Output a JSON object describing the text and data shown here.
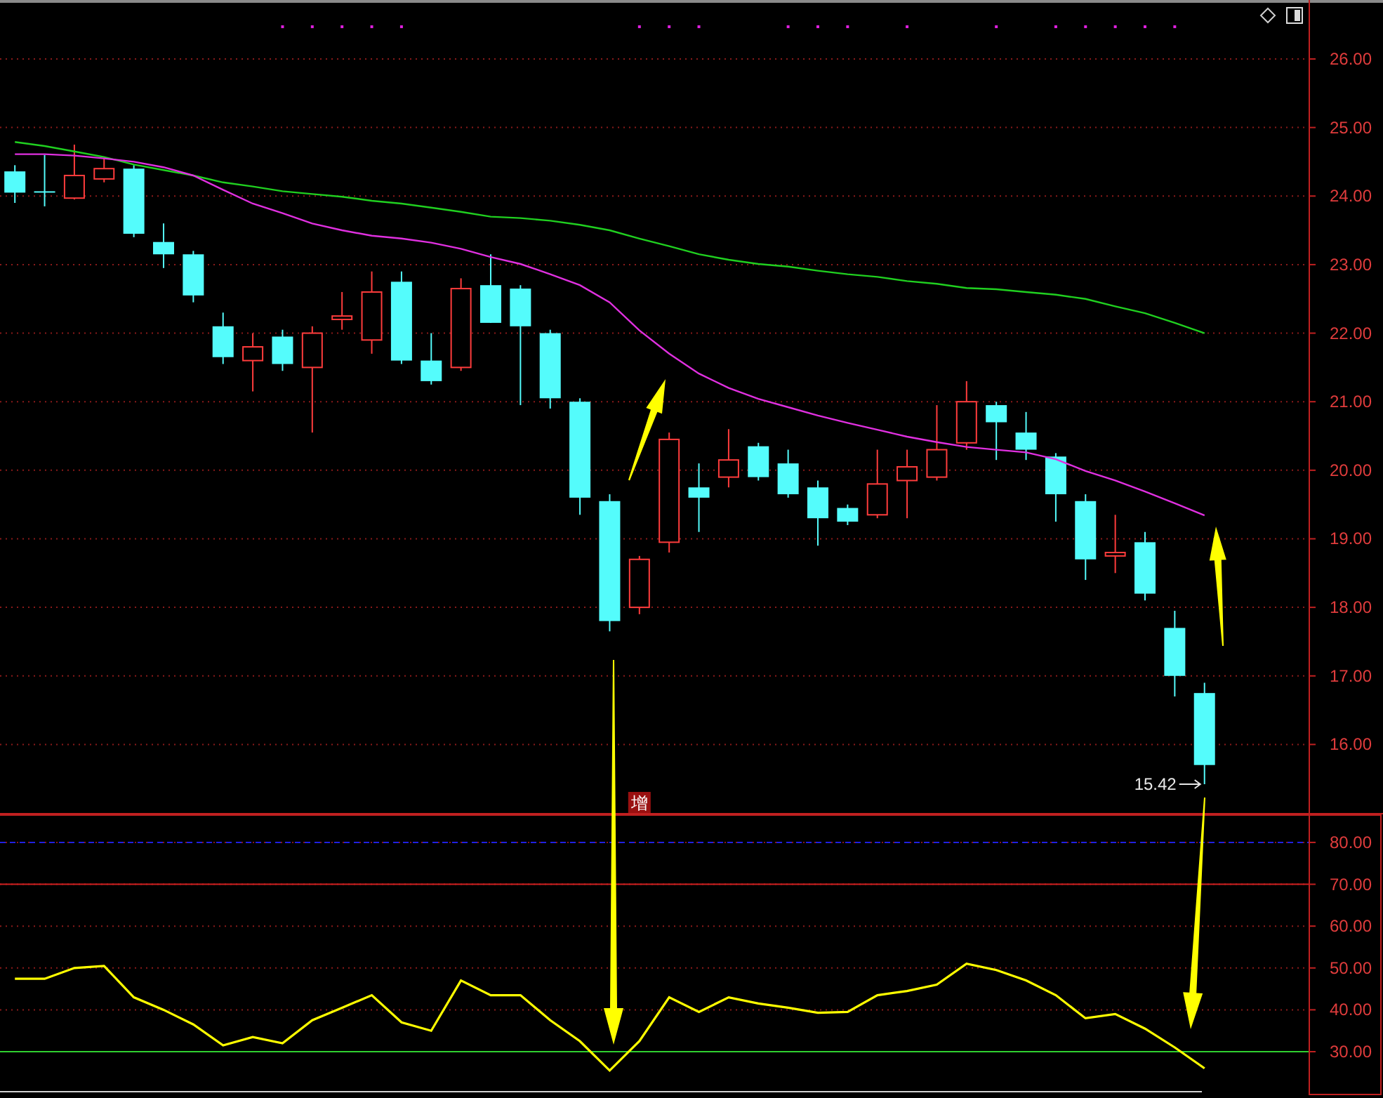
{
  "main_chart": {
    "chart_data": {
      "type": "candlestick",
      "grid": true,
      "ylim": [
        14.98,
        26.86
      ],
      "categories": [
        null,
        null,
        null,
        null,
        null,
        null,
        null,
        null,
        null,
        null,
        null,
        null,
        null,
        null,
        null,
        null,
        null,
        null,
        null,
        null,
        null,
        null,
        null,
        null,
        null,
        null,
        null,
        null,
        null,
        null,
        null,
        null,
        null,
        null,
        null,
        null,
        null,
        null,
        null,
        null,
        null,
        null,
        null,
        null
      ],
      "yticks": [
        {
          "value": 16,
          "label": "16.00"
        },
        {
          "value": 17,
          "label": "17.00"
        },
        {
          "value": 18,
          "label": "18.00"
        },
        {
          "value": 19,
          "label": "19.00"
        },
        {
          "value": 20,
          "label": "20.00"
        },
        {
          "value": 21,
          "label": "21.00"
        },
        {
          "value": 22,
          "label": "22.00"
        },
        {
          "value": 23,
          "label": "23.00"
        },
        {
          "value": 24,
          "label": "24.00"
        },
        {
          "value": 25,
          "label": "25.00"
        },
        {
          "value": 26,
          "label": "26.00"
        }
      ],
      "ohlc": [
        [
          24.36,
          24.45,
          23.9,
          24.05
        ],
        [
          24.07,
          24.6,
          23.85,
          24.05
        ],
        [
          23.97,
          24.75,
          23.95,
          24.3
        ],
        [
          24.25,
          24.55,
          24.2,
          24.4
        ],
        [
          24.4,
          24.45,
          23.4,
          23.45
        ],
        [
          23.33,
          23.6,
          22.95,
          23.15
        ],
        [
          23.15,
          23.2,
          22.45,
          22.55
        ],
        [
          22.1,
          22.3,
          21.55,
          21.65
        ],
        [
          21.6,
          22.0,
          21.15,
          21.8
        ],
        [
          21.95,
          22.05,
          21.45,
          21.55
        ],
        [
          21.5,
          22.1,
          20.55,
          22.0
        ],
        [
          22.2,
          22.6,
          22.05,
          22.25
        ],
        [
          21.9,
          22.9,
          21.7,
          22.6
        ],
        [
          22.75,
          22.9,
          21.55,
          21.6
        ],
        [
          21.6,
          22.0,
          21.25,
          21.3
        ],
        [
          21.5,
          22.8,
          21.45,
          22.65
        ],
        [
          22.7,
          23.15,
          22.15,
          22.15
        ],
        [
          22.65,
          22.7,
          20.95,
          22.1
        ],
        [
          22.0,
          22.05,
          20.9,
          21.05
        ],
        [
          21.0,
          21.05,
          19.35,
          19.6
        ],
        [
          19.55,
          19.65,
          17.65,
          17.8
        ],
        [
          18.0,
          18.75,
          17.9,
          18.7
        ],
        [
          18.95,
          20.55,
          18.8,
          20.45
        ],
        [
          19.75,
          20.1,
          19.1,
          19.6
        ],
        [
          19.9,
          20.6,
          19.75,
          20.15
        ],
        [
          20.35,
          20.4,
          19.85,
          19.9
        ],
        [
          20.1,
          20.3,
          19.6,
          19.65
        ],
        [
          19.75,
          19.85,
          18.9,
          19.3
        ],
        [
          19.45,
          19.5,
          19.2,
          19.25
        ],
        [
          19.35,
          20.3,
          19.3,
          19.8
        ],
        [
          19.85,
          20.3,
          19.3,
          20.05
        ],
        [
          19.9,
          20.95,
          19.85,
          20.3
        ],
        [
          20.4,
          21.3,
          20.3,
          21.0
        ],
        [
          20.95,
          21.0,
          20.15,
          20.7
        ],
        [
          20.55,
          20.85,
          20.15,
          20.3
        ],
        [
          20.2,
          20.25,
          19.25,
          19.65
        ],
        [
          19.55,
          19.65,
          18.4,
          18.7
        ],
        [
          18.75,
          19.35,
          18.5,
          18.8
        ],
        [
          18.95,
          19.1,
          18.1,
          18.2
        ],
        [
          17.7,
          17.95,
          16.7,
          17.0
        ],
        [
          16.75,
          16.9,
          15.42,
          15.7
        ],
        null,
        null,
        null
      ],
      "series": [
        {
          "color": "#20d020",
          "type": "line",
          "values": [
            24.79,
            24.73,
            24.65,
            24.57,
            24.46,
            24.38,
            24.3,
            24.2,
            24.14,
            24.07,
            24.03,
            23.99,
            23.93,
            23.89,
            23.83,
            23.77,
            23.7,
            23.68,
            23.64,
            23.58,
            23.5,
            23.38,
            23.27,
            23.15,
            23.07,
            23.01,
            22.97,
            22.91,
            22.86,
            22.82,
            22.76,
            22.72,
            22.66,
            22.64,
            22.6,
            22.56,
            22.5,
            22.39,
            22.29,
            22.15,
            22.0,
            null,
            null,
            null
          ]
        },
        {
          "color": "#e030e0",
          "type": "line",
          "values": [
            24.61,
            24.61,
            24.59,
            24.55,
            24.5,
            24.42,
            24.3,
            24.09,
            23.89,
            23.75,
            23.6,
            23.5,
            23.42,
            23.38,
            23.32,
            23.23,
            23.11,
            23.01,
            22.86,
            22.7,
            22.45,
            22.04,
            21.7,
            21.41,
            21.2,
            21.04,
            20.92,
            20.8,
            20.69,
            20.59,
            20.49,
            20.41,
            20.34,
            20.3,
            20.26,
            20.16,
            19.99,
            19.85,
            19.69,
            19.52,
            19.34,
            null,
            null,
            null
          ]
        },
        {
          "color": "#e020e0",
          "type": "scatter",
          "values": [
            null,
            null,
            null,
            null,
            null,
            null,
            null,
            null,
            null,
            26.47,
            26.47,
            26.47,
            26.47,
            26.47,
            null,
            null,
            null,
            null,
            null,
            null,
            null,
            26.47,
            26.47,
            26.47,
            null,
            null,
            26.47,
            26.47,
            26.47,
            null,
            26.47,
            null,
            null,
            26.47,
            null,
            26.47,
            26.47,
            26.47,
            26.47,
            26.47,
            null,
            null,
            null,
            null
          ]
        }
      ]
    },
    "last_price_label": "15.42",
    "tag_label": "增"
  },
  "indicator_chart": {
    "chart_data": {
      "type": "line",
      "grid": true,
      "ylim": [
        19.6,
        86.7
      ],
      "categories": [
        null,
        null,
        null,
        null,
        null,
        null,
        null,
        null,
        null,
        null,
        null,
        null,
        null,
        null,
        null,
        null,
        null,
        null,
        null,
        null,
        null,
        null,
        null,
        null,
        null,
        null,
        null,
        null,
        null,
        null,
        null,
        null,
        null,
        null,
        null,
        null,
        null,
        null,
        null,
        null,
        null,
        null,
        null,
        null
      ],
      "yticks": [
        {
          "value": 30,
          "label": "30.00"
        },
        {
          "value": 40,
          "label": "40.00"
        },
        {
          "value": 50,
          "label": "50.00"
        },
        {
          "value": 60,
          "label": "60.00"
        },
        {
          "value": 70,
          "label": "70.00"
        },
        {
          "value": 80,
          "label": "80.00"
        }
      ],
      "series": [
        {
          "color": "#ffff00",
          "values": [
            47.4,
            47.4,
            50,
            50.5,
            43,
            40,
            36.5,
            31.5,
            33.5,
            32,
            37.5,
            40.5,
            43.5,
            37,
            35,
            47,
            43.5,
            43.5,
            37.5,
            32.5,
            25.5,
            32.5,
            43,
            39.5,
            43,
            41.5,
            40.5,
            39.3,
            39.5,
            43.5,
            44.5,
            46,
            51,
            49.5,
            47,
            43.5,
            38,
            39,
            35.5,
            31,
            26,
            null,
            null,
            null
          ]
        }
      ],
      "ref_lines": [
        {
          "axis": "y",
          "value": 80,
          "color": "#2020e0"
        },
        {
          "axis": "y",
          "value": 70,
          "color": "#d02020"
        },
        {
          "axis": "y",
          "value": 30,
          "color": "#30d030"
        }
      ]
    }
  }
}
